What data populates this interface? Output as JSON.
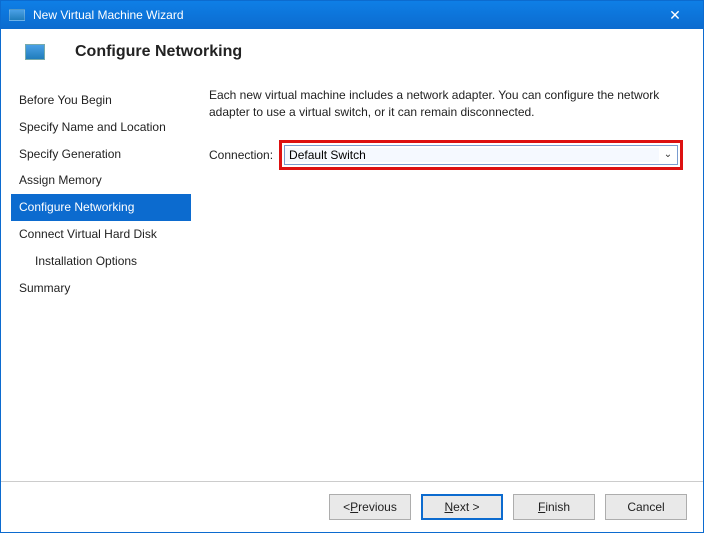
{
  "titlebar": {
    "title": "New Virtual Machine Wizard"
  },
  "header": {
    "title": "Configure Networking"
  },
  "sidebar": {
    "items": [
      {
        "label": "Before You Begin"
      },
      {
        "label": "Specify Name and Location"
      },
      {
        "label": "Specify Generation"
      },
      {
        "label": "Assign Memory"
      },
      {
        "label": "Configure Networking"
      },
      {
        "label": "Connect Virtual Hard Disk"
      },
      {
        "label": "Installation Options"
      },
      {
        "label": "Summary"
      }
    ],
    "selected_index": 4
  },
  "content": {
    "description": "Each new virtual machine includes a network adapter. You can configure the network adapter to use a virtual switch, or it can remain disconnected.",
    "connection_label": "Connection:",
    "connection_value": "Default Switch"
  },
  "footer": {
    "previous": "< Previous",
    "next": "Next >",
    "finish": "Finish",
    "cancel": "Cancel"
  }
}
